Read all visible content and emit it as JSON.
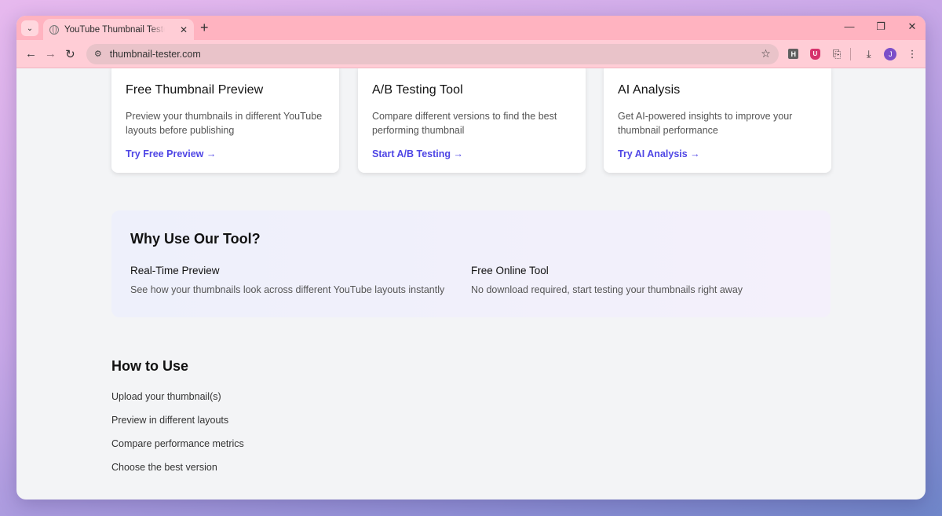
{
  "browser": {
    "tab": {
      "title": "YouTube Thumbnail Tester - Free"
    },
    "url": "thumbnail-tester.com",
    "profile_initial": "J",
    "extensions": {
      "h_label": "H",
      "u_label": "U"
    }
  },
  "features": [
    {
      "title": "Free Thumbnail Preview",
      "description": "Preview your thumbnails in different YouTube layouts before publishing",
      "link": "Try Free Preview →"
    },
    {
      "title": "A/B Testing Tool",
      "description": "Compare different versions to find the best performing thumbnail",
      "link": "Start A/B Testing →"
    },
    {
      "title": "AI Analysis",
      "description": "Get AI-powered insights to improve your thumbnail performance",
      "link": "Try AI Analysis →"
    }
  ],
  "why": {
    "heading": "Why Use Our Tool?",
    "items": [
      {
        "title": "Real-Time Preview",
        "text": "See how your thumbnails look across different YouTube layouts instantly"
      },
      {
        "title": "Free Online Tool",
        "text": "No download required, start testing your thumbnails right away"
      }
    ]
  },
  "how": {
    "heading": "How to Use",
    "steps": [
      "Upload your thumbnail(s)",
      "Preview in different layouts",
      "Compare performance metrics",
      "Choose the best version"
    ]
  },
  "colors": {
    "accent": "#4f46e5",
    "tabbar": "#ffb3c0",
    "toolbar": "#ffcdd6"
  }
}
